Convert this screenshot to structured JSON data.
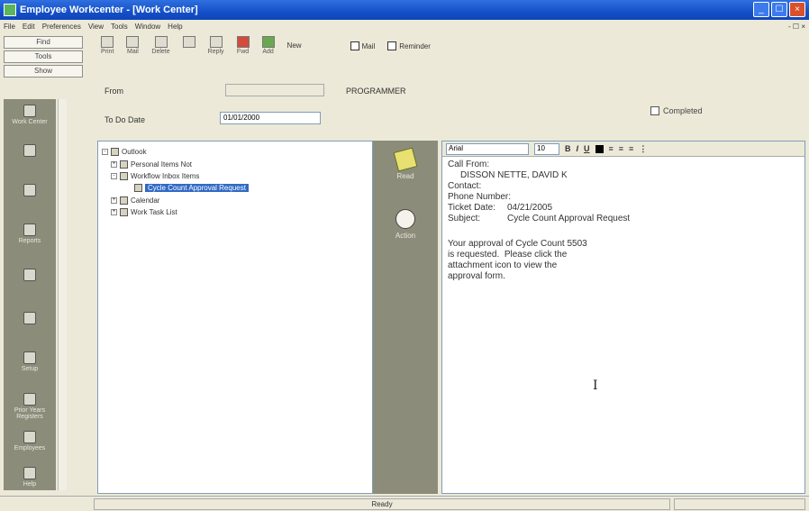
{
  "window": {
    "title": "Employee Workcenter - [Work Center]"
  },
  "menubar": {
    "items": [
      "File",
      "Edit",
      "Preferences",
      "View",
      "Tools",
      "Window",
      "Help"
    ],
    "mdi_controls": "- ☐ ×"
  },
  "sidebar": {
    "tabs": [
      "Find",
      "Tools",
      "Show"
    ],
    "nav_items": [
      "Work Center",
      "",
      "",
      "Reports",
      "",
      "",
      "Setup",
      "Prior Years Registers",
      "Employees",
      "Help"
    ]
  },
  "toolbar": {
    "buttons": [
      "Print",
      "Mail",
      "Delete",
      "",
      "Reply",
      "Fwd",
      "Add"
    ],
    "new_label": "New",
    "checkboxes": [
      "Mail",
      "Reminder"
    ]
  },
  "form": {
    "from_label": "From",
    "from_value": "",
    "from_name": "PROGRAMMER",
    "to_do_label": "To Do Date",
    "to_do_value": "01/01/2000",
    "completed_label": "Completed"
  },
  "tree": {
    "items": [
      {
        "label": "Outlook",
        "level": 0,
        "expander": "-"
      },
      {
        "label": "Personal Items Not",
        "level": 1,
        "expander": "+"
      },
      {
        "label": "Workflow Inbox Items",
        "level": 1,
        "expander": "-"
      },
      {
        "label": "Cycle Count Approval Request",
        "level": 2,
        "expander": "",
        "selected": true
      },
      {
        "label": "Calendar",
        "level": 1,
        "expander": "+"
      },
      {
        "label": "Work Task List",
        "level": 1,
        "expander": "+"
      }
    ]
  },
  "actions": {
    "items": [
      "Read",
      "Action"
    ]
  },
  "editor": {
    "font": "Arial",
    "size": "10",
    "call_from_label": "Call From:",
    "call_from_value": "DISSON NETTE, DAVID K",
    "contact_label": "Contact:",
    "phone_label": "Phone Number:",
    "ticket_label": "Ticket Date:",
    "ticket_value": "04/21/2005",
    "subject_label": "Subject:",
    "subject_value": "Cycle Count Approval Request",
    "body": [
      "Your approval of Cycle Count 5503",
      "is requested.  Please click the",
      "attachment icon to view the",
      "approval form."
    ]
  },
  "status": {
    "center": "Ready",
    "right": ""
  }
}
